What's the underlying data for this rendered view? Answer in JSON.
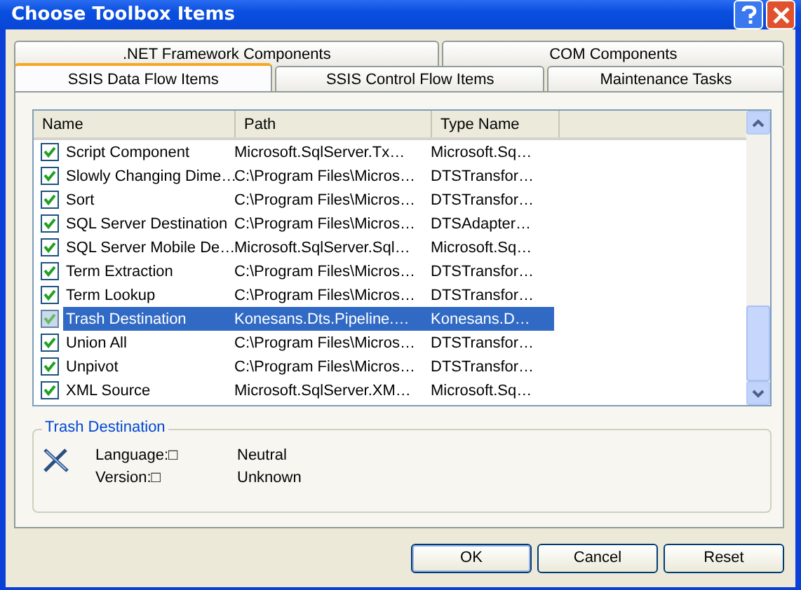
{
  "window": {
    "title": "Choose Toolbox Items"
  },
  "tab_rows": [
    [
      {
        "label": ".NET Framework Components",
        "selected": false
      },
      {
        "label": "COM Components",
        "selected": false
      }
    ],
    [
      {
        "label": "SSIS Data Flow Items",
        "selected": true
      },
      {
        "label": "SSIS Control Flow Items",
        "selected": false
      },
      {
        "label": "Maintenance Tasks",
        "selected": false
      }
    ]
  ],
  "table": {
    "columns": [
      "Name",
      "Path",
      "Type Name"
    ],
    "rows": [
      {
        "name": "Script Component",
        "path": "Microsoft.SqlServer.Tx…",
        "type_name": "Microsoft.Sq…",
        "checked": true,
        "selected": false
      },
      {
        "name": "Slowly Changing Dime…",
        "path": "C:\\Program Files\\Micros…",
        "type_name": "DTSTransfor…",
        "checked": true,
        "selected": false
      },
      {
        "name": "Sort",
        "path": "C:\\Program Files\\Micros…",
        "type_name": "DTSTransfor…",
        "checked": true,
        "selected": false
      },
      {
        "name": "SQL Server Destination",
        "path": "C:\\Program Files\\Micros…",
        "type_name": "DTSAdapter…",
        "checked": true,
        "selected": false
      },
      {
        "name": "SQL Server Mobile De…",
        "path": "Microsoft.SqlServer.Sql…",
        "type_name": "Microsoft.Sq…",
        "checked": true,
        "selected": false
      },
      {
        "name": "Term Extraction",
        "path": "C:\\Program Files\\Micros…",
        "type_name": "DTSTransfor…",
        "checked": true,
        "selected": false
      },
      {
        "name": "Term Lookup",
        "path": "C:\\Program Files\\Micros…",
        "type_name": "DTSTransfor…",
        "checked": true,
        "selected": false
      },
      {
        "name": "Trash Destination",
        "path": "Konesans.Dts.Pipeline.…",
        "type_name": "Konesans.D…",
        "checked": true,
        "selected": true
      },
      {
        "name": "Union All",
        "path": "C:\\Program Files\\Micros…",
        "type_name": "DTSTransfor…",
        "checked": true,
        "selected": false
      },
      {
        "name": "Unpivot",
        "path": "C:\\Program Files\\Micros…",
        "type_name": "DTSTransfor…",
        "checked": true,
        "selected": false
      },
      {
        "name": "XML Source",
        "path": "Microsoft.SqlServer.XM…",
        "type_name": "Microsoft.Sq…",
        "checked": true,
        "selected": false
      }
    ]
  },
  "details": {
    "title": "Trash Destination",
    "fields": [
      {
        "label": "Language:□",
        "value": "Neutral"
      },
      {
        "label": "Version:□",
        "value": "Unknown"
      }
    ]
  },
  "buttons": [
    "OK",
    "Cancel",
    "Reset"
  ]
}
